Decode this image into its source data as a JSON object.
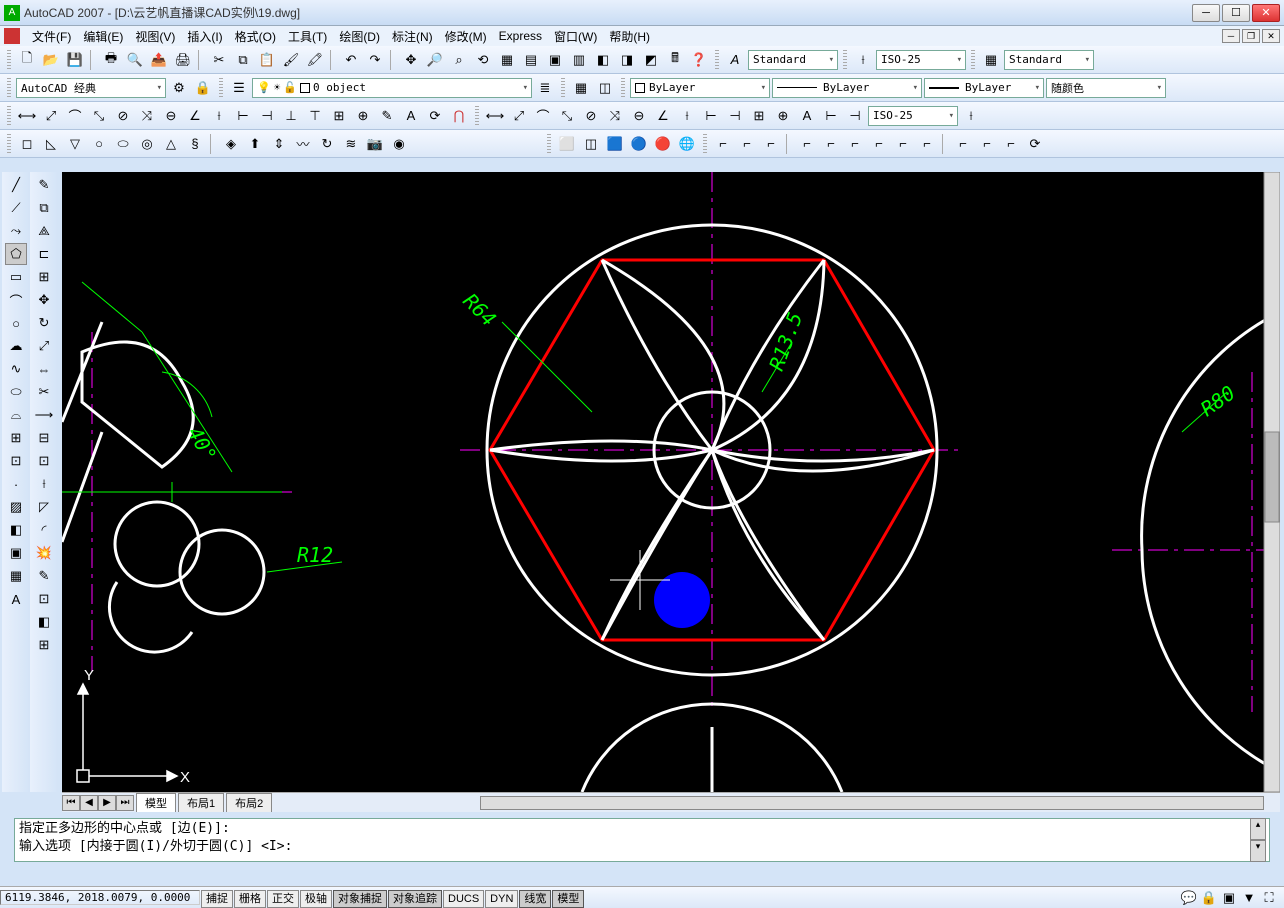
{
  "title": "AutoCAD 2007 - [D:\\云艺帆直播课CAD实例\\19.dwg]",
  "menu": [
    "文件(F)",
    "编辑(E)",
    "视图(V)",
    "插入(I)",
    "格式(O)",
    "工具(T)",
    "绘图(D)",
    "标注(N)",
    "修改(M)",
    "Express",
    "窗口(W)",
    "帮助(H)"
  ],
  "workspace": "AutoCAD 经典",
  "layer": "0 object",
  "linetype_bylayer": "ByLayer",
  "lineweight_bylayer": "ByLayer",
  "color_bylayer": "ByLayer",
  "plot_bylayer": "随颜色",
  "text_style": "Standard",
  "dim_style": "ISO-25",
  "table_style": "Standard",
  "dim_style2": "ISO-25",
  "tabs": {
    "model": "模型",
    "layout1": "布局1",
    "layout2": "布局2"
  },
  "cmd": {
    "line1": "指定正多边形的中心点或 [边(E)]:",
    "line2": "输入选项 [内接于圆(I)/外切于圆(C)] <I>:"
  },
  "status": {
    "coords": "6119.3846, 2018.0079, 0.0000",
    "buttons": [
      "捕捉",
      "栅格",
      "正交",
      "极轴",
      "对象捕捉",
      "对象追踪",
      "DUCS",
      "DYN",
      "线宽",
      "模型"
    ],
    "active": [
      false,
      false,
      false,
      false,
      true,
      true,
      false,
      false,
      true,
      true
    ]
  },
  "drawing_labels": {
    "r64": "R64",
    "r135": "R13.5",
    "r12": "R12",
    "r80": "R80",
    "ang40": "40°",
    "axisY": "Y",
    "axisX": "X"
  }
}
